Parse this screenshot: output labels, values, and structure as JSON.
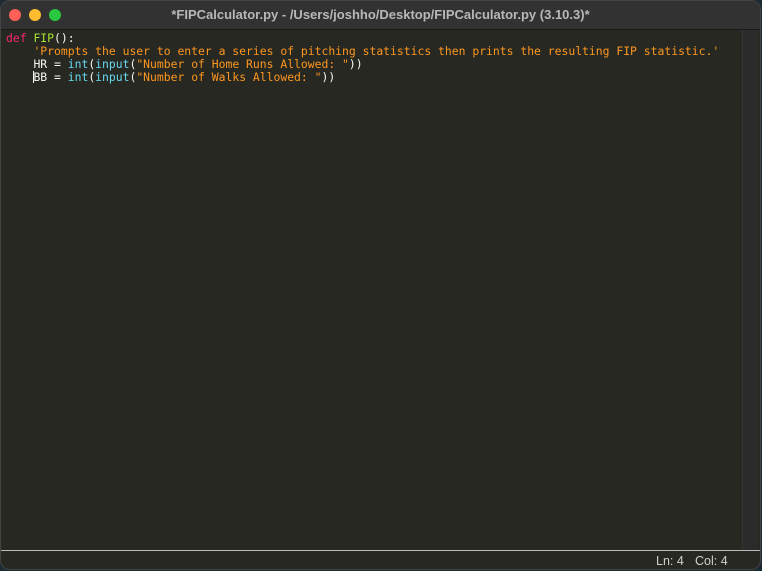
{
  "window": {
    "title": "*FIPCalculator.py - /Users/joshho/Desktop/FIPCalculator.py (3.10.3)*"
  },
  "code": {
    "l1": {
      "kw": "def",
      "fn": "FIP",
      "rest": "():"
    },
    "l2": {
      "str": "'Prompts the user to enter a series of pitching statistics then prints the resulting FIP statistic.'"
    },
    "l3": {
      "var": "HR = ",
      "int": "int",
      "p1": "(",
      "input": "input",
      "p2": "(",
      "str": "\"Number of Home Runs Allowed: \"",
      "end": "))"
    },
    "l4": {
      "var": "BB = ",
      "int": "int",
      "p1": "(",
      "input": "input",
      "p2": "(",
      "str": "\"Number of Walks Allowed: \"",
      "end": "))"
    }
  },
  "status": {
    "line": "Ln: 4",
    "col": "Col: 4"
  },
  "colors": {
    "keyword": "#f92672",
    "function": "#a6e22e",
    "string": "#fd971f",
    "builtin": "#66d9ef",
    "background": "#272822"
  }
}
